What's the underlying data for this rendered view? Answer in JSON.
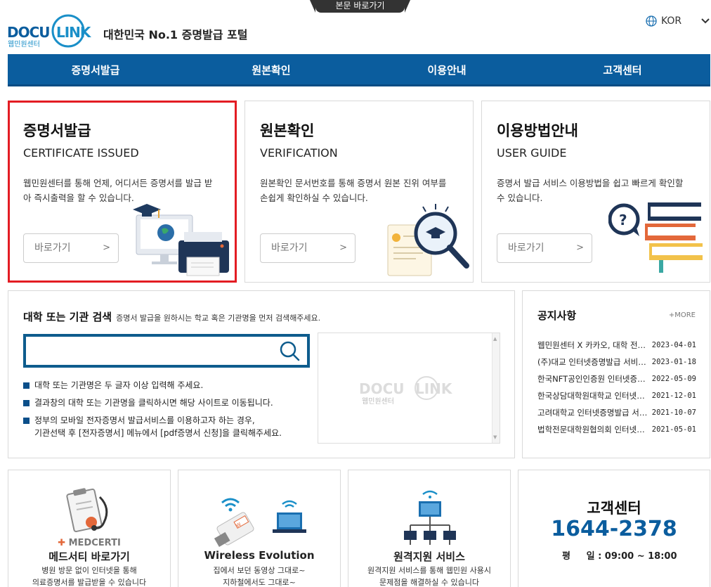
{
  "skip_link": "본문 바로가기",
  "header": {
    "logo_sub": "웹민원센터",
    "tagline": "대한민국 No.1 증명발급 포털",
    "language": "KOR"
  },
  "nav": [
    "증명서발급",
    "원본확인",
    "이용안내",
    "고객센터"
  ],
  "cards": [
    {
      "title": "증명서발급",
      "subtitle": "CERTIFICATE ISSUED",
      "desc": "웹민원센터를 통해 언제, 어디서든 증명서를 발급 받아 즉시출력을 할 수 있습니다.",
      "button": "바로가기",
      "arrow": ">"
    },
    {
      "title": "원본확인",
      "subtitle": "VERIFICATION",
      "desc": "원본확인 문서번호를 통해 증명서 원본 진위 여부를 손쉽게 확인하실 수 있습니다.",
      "button": "바로가기",
      "arrow": ">"
    },
    {
      "title": "이용방법안내",
      "subtitle": "USER GUIDE",
      "desc": "증명서 발급 서비스 이용방법을 쉽고 빠르게 확인할 수 있습니다.",
      "button": "바로가기",
      "arrow": ">"
    }
  ],
  "search": {
    "title": "대학 또는 기관 검색",
    "hint": "증명서 발급을 원하시는 학교 혹은 기관명을 먼저 검색해주세요.",
    "value": "",
    "notes": [
      "대학 또는 기관명은 두 글자 이상 입력해 주세요.",
      "결과창의 대학 또는 기관명을 클릭하시면 해당 사이트로 이동됩니다.",
      "정부의 모바일 전자증명서 발급서비스를 이용하고자 하는 경우,",
      "기관선택 후 [전자증명서] 메뉴에서 [pdf증명서 신청]을 클릭해주세요."
    ],
    "watermark_sub": "웹민원센터"
  },
  "notice": {
    "title": "공지사항",
    "more": "+MORE",
    "items": [
      {
        "title": "웹민원센터 X 카카오, 대학 전자증명서",
        "date": "2023-04-01"
      },
      {
        "title": "(주)대교 인터넷증명발급 서비스 오픈",
        "date": "2023-01-18"
      },
      {
        "title": "한국NFT공인인증원 인터넷증명발급",
        "date": "2022-05-09"
      },
      {
        "title": "한국상담대학원대학교 인터넷증명발급",
        "date": "2021-12-01"
      },
      {
        "title": "고려대학교 인터넷증명발급 서비스",
        "date": "2021-10-07"
      },
      {
        "title": "법학전문대학원협의회 인터넷증명발급",
        "date": "2021-05-01"
      }
    ]
  },
  "tiles": [
    {
      "brand": "MEDCERTI",
      "title": "메드서티 바로가기",
      "line1": "병원 방문 없이 인터넷을 통해",
      "line2": "의료증명서를 발급받을 수 있습니다"
    },
    {
      "badge": "W",
      "title": "Wireless Evolution",
      "line1": "집에서 보던 동영상 그대로~",
      "line2": "지하철에서도 그대로~"
    },
    {
      "title": "원격지원 서비스",
      "line1": "원격지원 서비스를 통해 웹민원 사용시",
      "line2": "문제점을 해결하실 수 있습니다"
    }
  ],
  "customer_center": {
    "title": "고객센터",
    "phone": "1644-2378",
    "hours": "평     일 : 09:00 ~ 18:00"
  },
  "colors": {
    "brand_blue": "#0b5d9e",
    "highlight_red": "#e31c23",
    "logo_cyan": "#1a8fc8"
  }
}
